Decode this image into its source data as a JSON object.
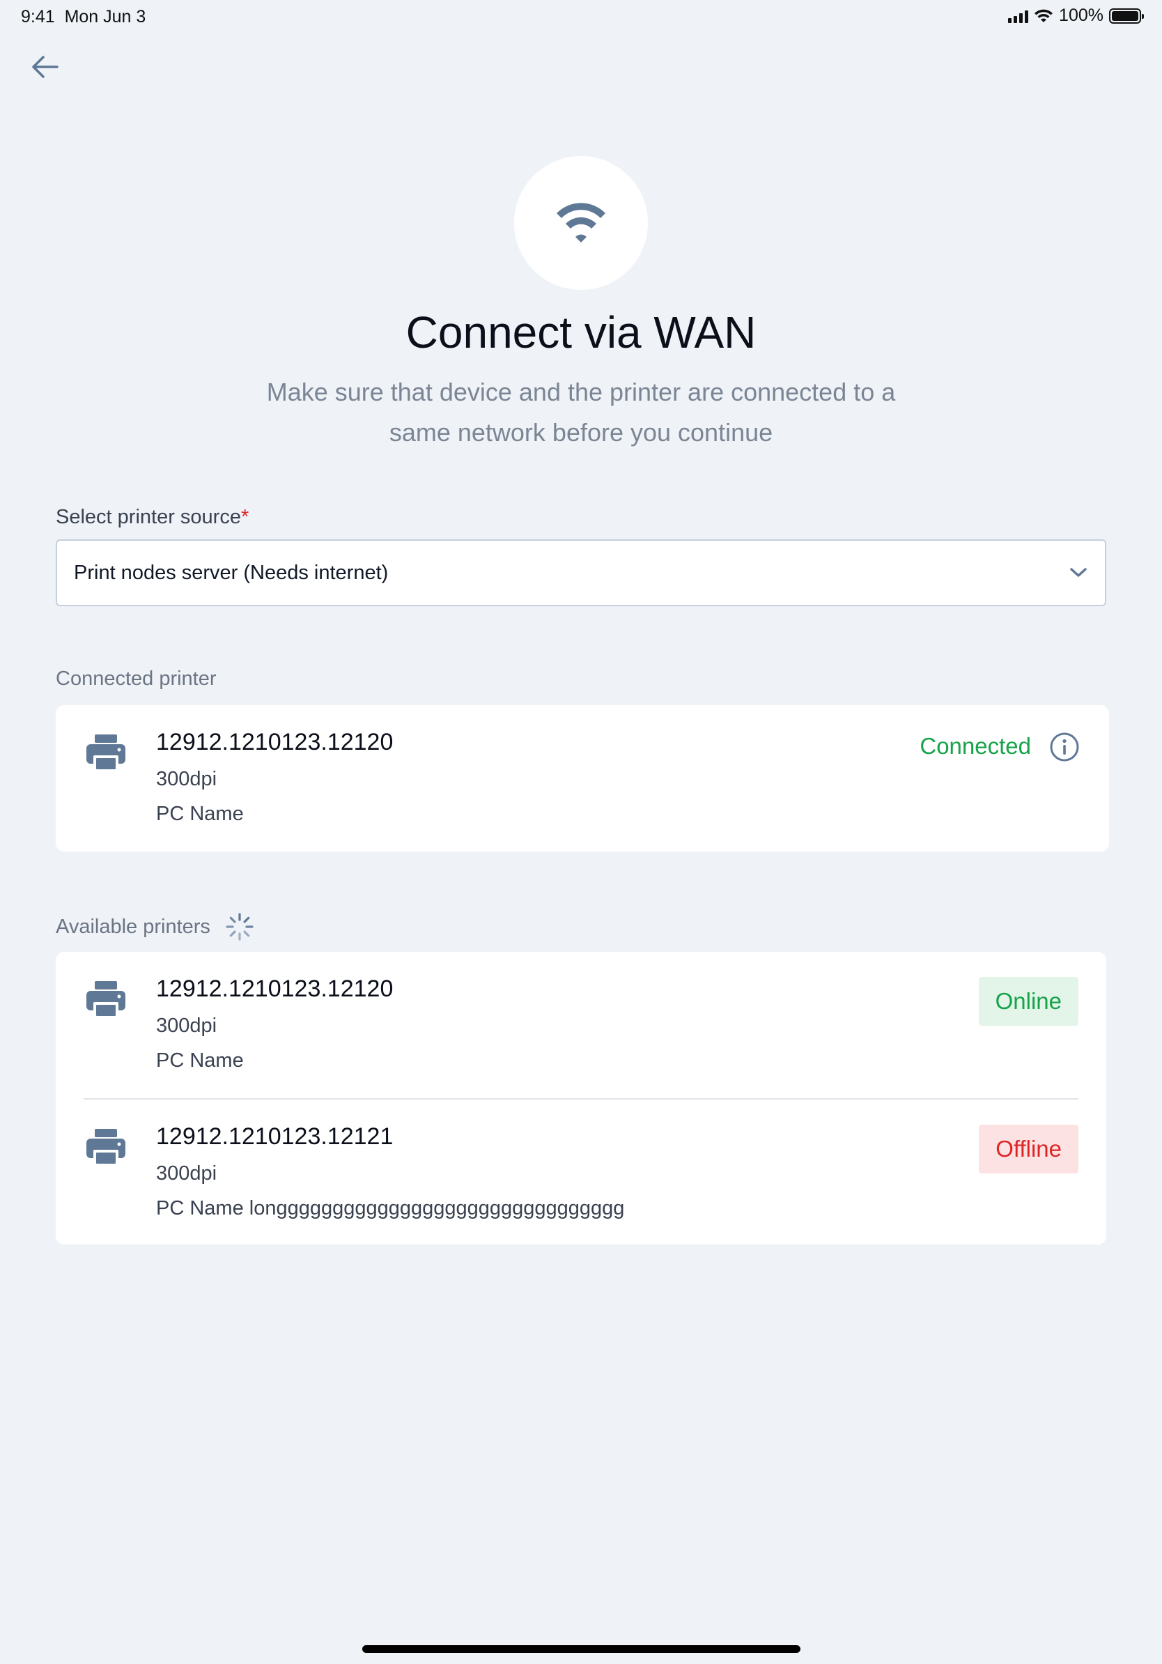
{
  "status_bar": {
    "time": "9:41",
    "date": "Mon Jun 3",
    "battery": "100%"
  },
  "header": {
    "title": "Connect via WAN",
    "subtitle": "Make sure that device and the printer are connected to a same network before you continue",
    "hero_icon": "wifi-icon"
  },
  "source_field": {
    "label": "Select printer source",
    "required_mark": "*",
    "value": "Print nodes server (Needs internet)"
  },
  "connected_section": {
    "label": "Connected printer",
    "printer": {
      "id": "12912.1210123.12120",
      "dpi": "300dpi",
      "pc_name": "PC Name",
      "status": "Connected"
    }
  },
  "available_section": {
    "label": "Available printers",
    "printers": [
      {
        "id": "12912.1210123.12120",
        "dpi": "300dpi",
        "pc_name": "PC Name",
        "status": "Online"
      },
      {
        "id": "12912.1210123.12121",
        "dpi": "300dpi",
        "pc_name": "PC Name longgggggggggggggggggggggggggggggg",
        "status": "Offline"
      }
    ]
  },
  "colors": {
    "background": "#eff3f8",
    "icon": "#5f7896",
    "success": "#16a34a",
    "danger": "#dc2626"
  }
}
